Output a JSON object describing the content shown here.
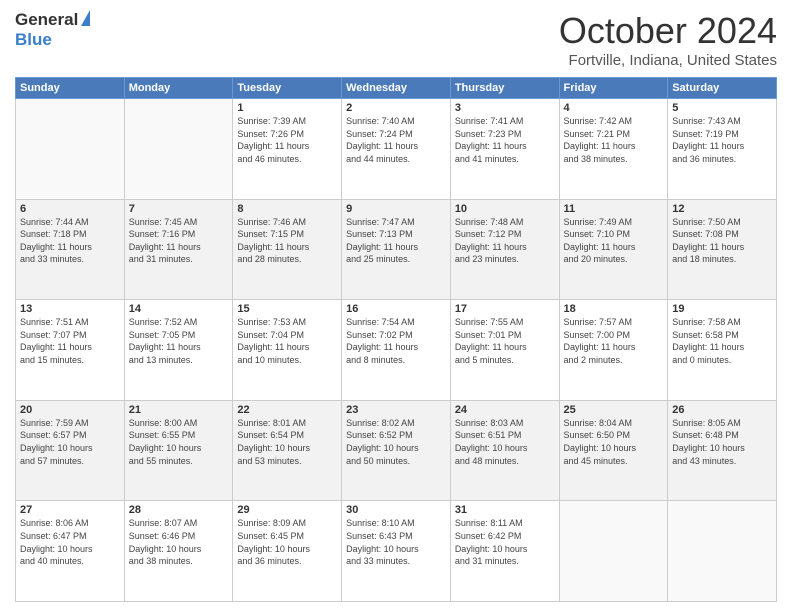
{
  "header": {
    "logo_general": "General",
    "logo_blue": "Blue",
    "title": "October 2024",
    "subtitle": "Fortville, Indiana, United States"
  },
  "calendar": {
    "days_of_week": [
      "Sunday",
      "Monday",
      "Tuesday",
      "Wednesday",
      "Thursday",
      "Friday",
      "Saturday"
    ],
    "weeks": [
      [
        {
          "num": "",
          "info": ""
        },
        {
          "num": "",
          "info": ""
        },
        {
          "num": "1",
          "info": "Sunrise: 7:39 AM\nSunset: 7:26 PM\nDaylight: 11 hours\nand 46 minutes."
        },
        {
          "num": "2",
          "info": "Sunrise: 7:40 AM\nSunset: 7:24 PM\nDaylight: 11 hours\nand 44 minutes."
        },
        {
          "num": "3",
          "info": "Sunrise: 7:41 AM\nSunset: 7:23 PM\nDaylight: 11 hours\nand 41 minutes."
        },
        {
          "num": "4",
          "info": "Sunrise: 7:42 AM\nSunset: 7:21 PM\nDaylight: 11 hours\nand 38 minutes."
        },
        {
          "num": "5",
          "info": "Sunrise: 7:43 AM\nSunset: 7:19 PM\nDaylight: 11 hours\nand 36 minutes."
        }
      ],
      [
        {
          "num": "6",
          "info": "Sunrise: 7:44 AM\nSunset: 7:18 PM\nDaylight: 11 hours\nand 33 minutes."
        },
        {
          "num": "7",
          "info": "Sunrise: 7:45 AM\nSunset: 7:16 PM\nDaylight: 11 hours\nand 31 minutes."
        },
        {
          "num": "8",
          "info": "Sunrise: 7:46 AM\nSunset: 7:15 PM\nDaylight: 11 hours\nand 28 minutes."
        },
        {
          "num": "9",
          "info": "Sunrise: 7:47 AM\nSunset: 7:13 PM\nDaylight: 11 hours\nand 25 minutes."
        },
        {
          "num": "10",
          "info": "Sunrise: 7:48 AM\nSunset: 7:12 PM\nDaylight: 11 hours\nand 23 minutes."
        },
        {
          "num": "11",
          "info": "Sunrise: 7:49 AM\nSunset: 7:10 PM\nDaylight: 11 hours\nand 20 minutes."
        },
        {
          "num": "12",
          "info": "Sunrise: 7:50 AM\nSunset: 7:08 PM\nDaylight: 11 hours\nand 18 minutes."
        }
      ],
      [
        {
          "num": "13",
          "info": "Sunrise: 7:51 AM\nSunset: 7:07 PM\nDaylight: 11 hours\nand 15 minutes."
        },
        {
          "num": "14",
          "info": "Sunrise: 7:52 AM\nSunset: 7:05 PM\nDaylight: 11 hours\nand 13 minutes."
        },
        {
          "num": "15",
          "info": "Sunrise: 7:53 AM\nSunset: 7:04 PM\nDaylight: 11 hours\nand 10 minutes."
        },
        {
          "num": "16",
          "info": "Sunrise: 7:54 AM\nSunset: 7:02 PM\nDaylight: 11 hours\nand 8 minutes."
        },
        {
          "num": "17",
          "info": "Sunrise: 7:55 AM\nSunset: 7:01 PM\nDaylight: 11 hours\nand 5 minutes."
        },
        {
          "num": "18",
          "info": "Sunrise: 7:57 AM\nSunset: 7:00 PM\nDaylight: 11 hours\nand 2 minutes."
        },
        {
          "num": "19",
          "info": "Sunrise: 7:58 AM\nSunset: 6:58 PM\nDaylight: 11 hours\nand 0 minutes."
        }
      ],
      [
        {
          "num": "20",
          "info": "Sunrise: 7:59 AM\nSunset: 6:57 PM\nDaylight: 10 hours\nand 57 minutes."
        },
        {
          "num": "21",
          "info": "Sunrise: 8:00 AM\nSunset: 6:55 PM\nDaylight: 10 hours\nand 55 minutes."
        },
        {
          "num": "22",
          "info": "Sunrise: 8:01 AM\nSunset: 6:54 PM\nDaylight: 10 hours\nand 53 minutes."
        },
        {
          "num": "23",
          "info": "Sunrise: 8:02 AM\nSunset: 6:52 PM\nDaylight: 10 hours\nand 50 minutes."
        },
        {
          "num": "24",
          "info": "Sunrise: 8:03 AM\nSunset: 6:51 PM\nDaylight: 10 hours\nand 48 minutes."
        },
        {
          "num": "25",
          "info": "Sunrise: 8:04 AM\nSunset: 6:50 PM\nDaylight: 10 hours\nand 45 minutes."
        },
        {
          "num": "26",
          "info": "Sunrise: 8:05 AM\nSunset: 6:48 PM\nDaylight: 10 hours\nand 43 minutes."
        }
      ],
      [
        {
          "num": "27",
          "info": "Sunrise: 8:06 AM\nSunset: 6:47 PM\nDaylight: 10 hours\nand 40 minutes."
        },
        {
          "num": "28",
          "info": "Sunrise: 8:07 AM\nSunset: 6:46 PM\nDaylight: 10 hours\nand 38 minutes."
        },
        {
          "num": "29",
          "info": "Sunrise: 8:09 AM\nSunset: 6:45 PM\nDaylight: 10 hours\nand 36 minutes."
        },
        {
          "num": "30",
          "info": "Sunrise: 8:10 AM\nSunset: 6:43 PM\nDaylight: 10 hours\nand 33 minutes."
        },
        {
          "num": "31",
          "info": "Sunrise: 8:11 AM\nSunset: 6:42 PM\nDaylight: 10 hours\nand 31 minutes."
        },
        {
          "num": "",
          "info": ""
        },
        {
          "num": "",
          "info": ""
        }
      ]
    ]
  }
}
